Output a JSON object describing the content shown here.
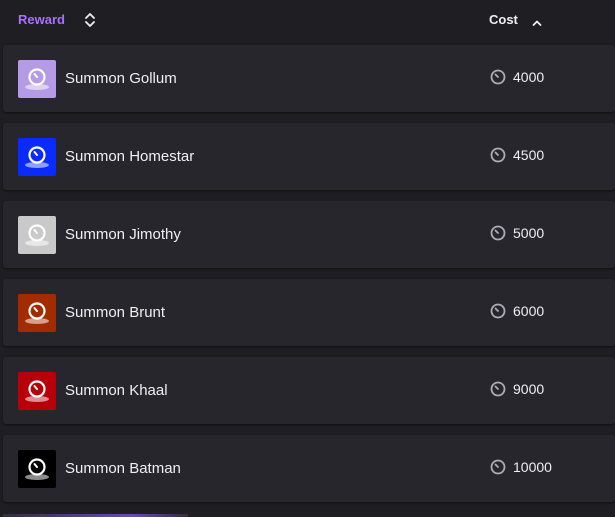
{
  "header": {
    "reward_label": "Reward",
    "cost_label": "Cost",
    "reward_sort_icon": "sort-both-icon",
    "cost_sort_icon": "sort-ascending-icon",
    "reward_color": "#a970ff"
  },
  "rewards": [
    {
      "name": "Summon Gollum",
      "cost": "4000",
      "icon": "channel-points-reward-icon",
      "color": "#b59ae6"
    },
    {
      "name": "Summon Homestar",
      "cost": "4500",
      "icon": "channel-points-reward-icon",
      "color": "#0a2bff"
    },
    {
      "name": "Summon Jimothy",
      "cost": "5000",
      "icon": "channel-points-reward-icon",
      "color": "#c9c9c9"
    },
    {
      "name": "Summon Brunt",
      "cost": "6000",
      "icon": "channel-points-reward-icon",
      "color": "#a32b00"
    },
    {
      "name": "Summon Khaal",
      "cost": "9000",
      "icon": "channel-points-reward-icon",
      "color": "#b8000a"
    },
    {
      "name": "Summon Batman",
      "cost": "10000",
      "icon": "channel-points-reward-icon",
      "color": "#000000"
    }
  ],
  "cost_icon": "channel-points-icon"
}
